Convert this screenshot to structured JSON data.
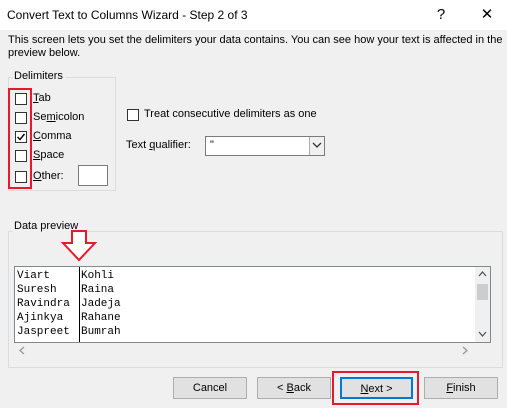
{
  "window": {
    "title": "Convert Text to Columns Wizard - Step 2 of 3",
    "help_glyph": "?",
    "close_glyph": "✕"
  },
  "description": "This screen lets you set the delimiters your data contains.  You can see how your text is affected in the preview below.",
  "delimiters": {
    "group_label": "Delimiters",
    "items": [
      {
        "label": "Tab",
        "accel": "T",
        "checked": false
      },
      {
        "label": "Semicolon",
        "accel": "m",
        "checked": false
      },
      {
        "label": "Comma",
        "accel": "C",
        "checked": true
      },
      {
        "label": "Space",
        "accel": "S",
        "checked": false
      },
      {
        "label": "Other:",
        "accel": "O",
        "checked": false
      }
    ],
    "other_value": ""
  },
  "options": {
    "consecutive_label": "Treat consecutive delimiters as one",
    "consecutive_accel": "R",
    "consecutive_checked": false,
    "qualifier_label": "Text qualifier:",
    "qualifier_accel": "q",
    "qualifier_value": "\""
  },
  "preview": {
    "group_label": "Data preview",
    "rows": [
      [
        "Viart",
        "Kohli"
      ],
      [
        "Suresh",
        "Raina"
      ],
      [
        "Ravindra",
        "Jadeja"
      ],
      [
        "Ajinkya",
        "Rahane"
      ],
      [
        "Jaspreet",
        "Bumrah"
      ]
    ]
  },
  "buttons": {
    "cancel": "Cancel",
    "back": "< Back",
    "back_accel": "B",
    "next": "Next >",
    "next_accel": "N",
    "finish": "Finish",
    "finish_accel": "F"
  },
  "annotation_color": "#e8192c"
}
